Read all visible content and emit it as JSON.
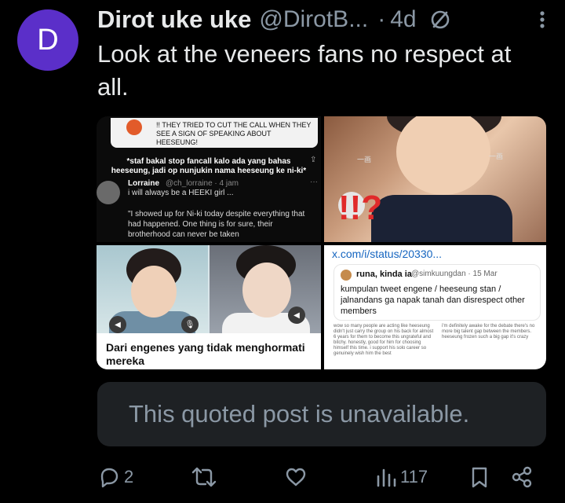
{
  "author": {
    "avatar_letter": "D",
    "avatar_color": "#5b2fc9",
    "display_name": "Dirot uke uke",
    "handle": "@DirotB...",
    "separator": "·",
    "time": "4d"
  },
  "post": {
    "text": "Look at the veneers fans no respect at all."
  },
  "media": {
    "cell1": {
      "banner": "!! THEY TRIED TO CUT THE CALL WHEN THEY SEE A SIGN OF SPEAKING ABOUT HEESEUNG!",
      "bold_text": "*staf bakal stop fancall kalo ada yang bahas heeseung, jadi op nunjukin nama heeseung ke ni-ki*",
      "share_icon": "⇪",
      "user_name": "Lorraine",
      "user_handle": "@ch_lorraine · 4 jam",
      "dots": "···",
      "user_text": "i will always be a HEEKI girl ...",
      "quote": "\"I showed up for Ni-ki today despite everything that had happened. One thing is for sure, their brotherhood can never be taken"
    },
    "cell2": {
      "overlay": "!!?",
      "wm1": "一画",
      "wm2": "一画"
    },
    "cell3": {
      "caption": "Dari engenes yang tidak menghormati mereka",
      "pip1": "◀",
      "pip2": "🎙",
      "pip3": "◀"
    },
    "cell4": {
      "url": "x.com/i/status/20330...",
      "card_name": "runa, kinda ia",
      "card_handle": "@simkuungdan · 15 Mar",
      "card_text": "kumpulan tweet engene / heeseung stan / jalnandans ga napak tanah dan disrespect other members",
      "mini_left": "wow so many people are acting like heeseung didn't just carry the group on his back for almost 6 years for them to become this ungrateful and bitchy. honestly, good for him for choosing himself this time. i support his solo career so genuinely wish him the best",
      "mini_right": "i'm definitely awake for the debate there's no more big talent gap between the members. heeseung frozen such a big gap it's crazy"
    }
  },
  "quoted_post": {
    "text": "This quoted post is unavailable."
  },
  "actions": {
    "reply_count": "2",
    "repost_count": "",
    "like_count": "",
    "views_count": "117"
  },
  "icons": {
    "no_edit": "slash-circle-icon",
    "more": "more-icon",
    "reply": "reply-icon",
    "repost": "repost-icon",
    "like": "heart-icon",
    "views": "views-icon",
    "bookmark": "bookmark-icon",
    "share": "share-icon"
  }
}
